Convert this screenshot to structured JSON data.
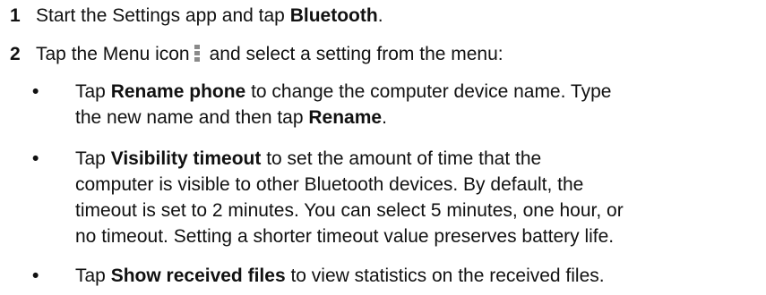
{
  "steps": [
    {
      "number": "1",
      "text_before": "Start the Settings app and tap ",
      "bold": "Bluetooth",
      "text_after": "."
    },
    {
      "number": "2",
      "text_before": "Tap the Menu icon",
      "icon": "menu-overflow-icon",
      "text_after": "and select a setting from the menu:"
    }
  ],
  "bullets": [
    {
      "marker": "•",
      "lines": [
        [
          {
            "t": "Tap "
          },
          {
            "t": "Rename phone",
            "b": true
          },
          {
            "t": " to change the computer device name. Type"
          }
        ],
        [
          {
            "t": "the new name and then tap "
          },
          {
            "t": "Rename",
            "b": true
          },
          {
            "t": "."
          }
        ]
      ]
    },
    {
      "marker": "•",
      "lines": [
        [
          {
            "t": "Tap "
          },
          {
            "t": "Visibility timeout",
            "b": true
          },
          {
            "t": " to set the amount of time that the"
          }
        ],
        [
          {
            "t": "computer is visible to other Bluetooth devices. By default, the"
          }
        ],
        [
          {
            "t": "timeout is set to 2 minutes. You can select 5 minutes, one hour, or"
          }
        ],
        [
          {
            "t": "no timeout. Setting a shorter timeout value preserves battery life."
          }
        ]
      ]
    },
    {
      "marker": "•",
      "lines": [
        [
          {
            "t": "Tap "
          },
          {
            "t": "Show received files",
            "b": true
          },
          {
            "t": " to view statistics on the received files."
          }
        ]
      ]
    }
  ],
  "colors": {
    "text": "#111111",
    "icon": "#8a8a8a"
  }
}
